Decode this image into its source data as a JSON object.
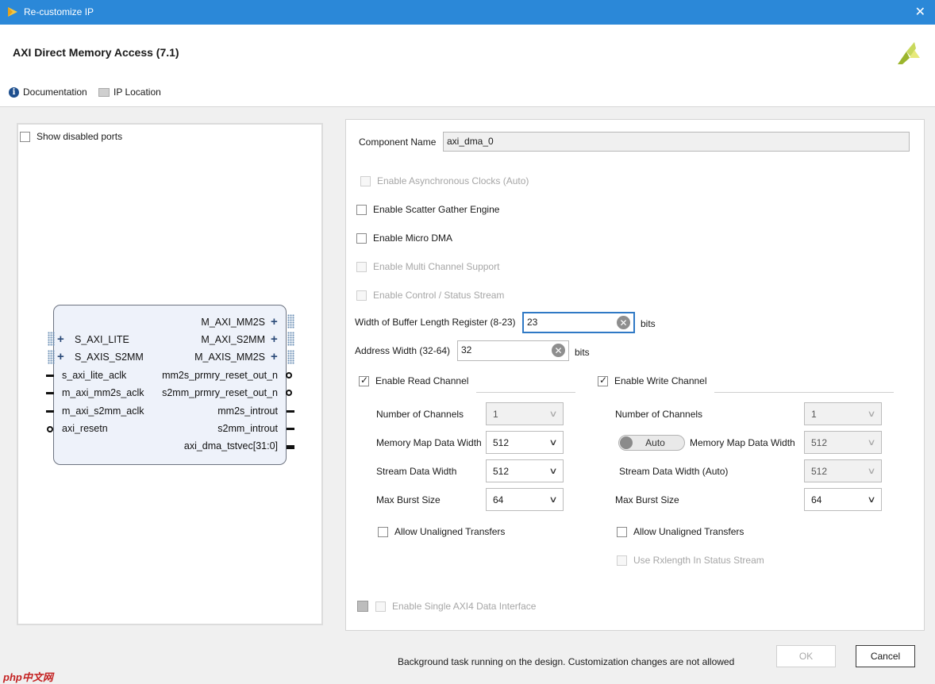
{
  "window": {
    "title": "Re-customize IP",
    "close_glyph": "✕"
  },
  "header": {
    "ip_title": "AXI Direct Memory Access (7.1)",
    "documentation": "Documentation",
    "ip_location": "IP Location",
    "logo_icon": "xilinx-logo-icon"
  },
  "left_panel": {
    "show_disabled_ports": "Show disabled ports",
    "ports_left": [
      {
        "label": "S_AXI_LITE",
        "kind": "bus"
      },
      {
        "label": "S_AXIS_S2MM",
        "kind": "bus"
      },
      {
        "label": "s_axi_lite_aclk",
        "kind": "pin"
      },
      {
        "label": "m_axi_mm2s_aclk",
        "kind": "pin"
      },
      {
        "label": "m_axi_s2mm_aclk",
        "kind": "pin"
      },
      {
        "label": "axi_resetn",
        "kind": "inverted"
      }
    ],
    "ports_right": [
      {
        "label": "M_AXI_MM2S",
        "kind": "bus"
      },
      {
        "label": "M_AXI_S2MM",
        "kind": "bus"
      },
      {
        "label": "M_AXIS_MM2S",
        "kind": "bus"
      },
      {
        "label": "mm2s_prmry_reset_out_n",
        "kind": "inverted"
      },
      {
        "label": "s2mm_prmry_reset_out_n",
        "kind": "inverted"
      },
      {
        "label": "mm2s_introut",
        "kind": "pin"
      },
      {
        "label": "s2mm_introut",
        "kind": "pin"
      },
      {
        "label": "axi_dma_tstvec[31:0]",
        "kind": "bus-pin"
      }
    ]
  },
  "config": {
    "component_name_label": "Component Name",
    "component_name_value": "axi_dma_0",
    "async_clocks": "Enable Asynchronous Clocks (Auto)",
    "scatter_gather": "Enable Scatter Gather Engine",
    "micro_dma": "Enable Micro DMA",
    "multi_channel": "Enable Multi Channel Support",
    "control_status": "Enable Control / Status Stream",
    "buffer_len_label": "Width of Buffer Length Register (8-23)",
    "buffer_len_value": "23",
    "buffer_len_unit": "bits",
    "addr_width_label": "Address Width (32-64)",
    "addr_width_value": "32",
    "addr_width_unit": "bits",
    "read_channel": {
      "title": "Enable Read Channel",
      "num_channels_label": "Number of Channels",
      "num_channels_value": "1",
      "mm_width_label": "Memory Map Data Width",
      "mm_width_value": "512",
      "stream_width_label": "Stream Data Width",
      "stream_width_value": "512",
      "burst_label": "Max Burst Size",
      "burst_value": "64",
      "unaligned": "Allow Unaligned Transfers"
    },
    "write_channel": {
      "title": "Enable Write Channel",
      "num_channels_label": "Number of Channels",
      "num_channels_value": "1",
      "auto_toggle": "Auto",
      "mm_width_label": "Memory Map Data Width",
      "mm_width_value": "512",
      "stream_width_label": "Stream Data Width (Auto)",
      "stream_width_value": "512",
      "burst_label": "Max Burst Size",
      "burst_value": "64",
      "unaligned": "Allow Unaligned Transfers",
      "rxlength": "Use Rxlength In Status Stream"
    },
    "single_axi4": "Enable Single AXI4 Data Interface"
  },
  "footer": {
    "status": "Background task running on the design. Customization changes are not allowed",
    "ok": "OK",
    "cancel": "Cancel"
  },
  "watermark": "php中文网"
}
